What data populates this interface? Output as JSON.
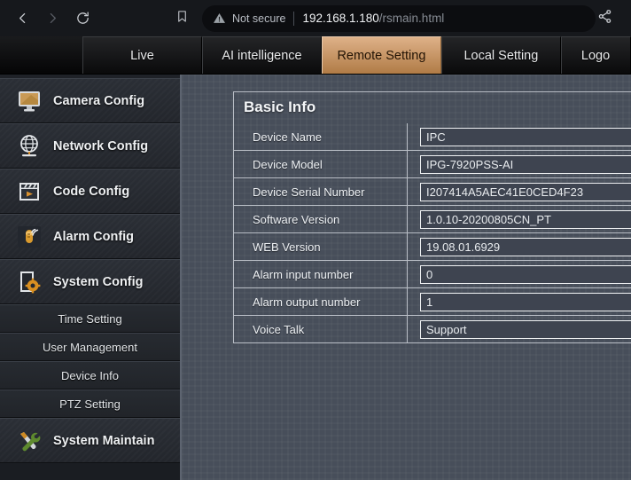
{
  "browser": {
    "back_icon": "back-arrow-icon",
    "forward_icon": "forward-arrow-icon",
    "reload_icon": "reload-icon",
    "bookmark_icon": "bookmark-icon",
    "security_icon": "warning-triangle-icon",
    "security_label": "Not secure",
    "url_host": "192.168.1.180",
    "url_path": "/rsmain.html",
    "share_icon": "share-icon"
  },
  "tabs": [
    {
      "label": "Live",
      "active": false
    },
    {
      "label": "AI intelligence",
      "active": false
    },
    {
      "label": "Remote Setting",
      "active": true
    },
    {
      "label": "Local Setting",
      "active": false
    },
    {
      "label": "Logo",
      "active": false
    }
  ],
  "sidebar": {
    "items": [
      {
        "label": "Camera Config",
        "icon": "monitor-icon"
      },
      {
        "label": "Network Config",
        "icon": "globe-icon"
      },
      {
        "label": "Code Config",
        "icon": "film-play-icon"
      },
      {
        "label": "Alarm Config",
        "icon": "alarm-bell-icon"
      },
      {
        "label": "System Config",
        "icon": "document-gear-icon"
      }
    ],
    "subitems": [
      {
        "label": "Time Setting"
      },
      {
        "label": "User Management"
      },
      {
        "label": "Device Info"
      },
      {
        "label": "PTZ Setting"
      }
    ],
    "maintain": {
      "label": "System Maintain",
      "icon": "wrench-screwdriver-icon"
    }
  },
  "main": {
    "panel_title": "Basic Info",
    "rows": [
      {
        "label": "Device Name",
        "value": "IPC"
      },
      {
        "label": "Device Model",
        "value": "IPG-7920PSS-AI"
      },
      {
        "label": "Device Serial Number",
        "value": "I207414A5AEC41E0CED4F23"
      },
      {
        "label": "Software Version",
        "value": "1.0.10-20200805CN_PT"
      },
      {
        "label": "WEB Version",
        "value": "19.08.01.6929"
      },
      {
        "label": "Alarm input number",
        "value": "0"
      },
      {
        "label": "Alarm output number",
        "value": "1"
      },
      {
        "label": "Voice Talk",
        "value": "Support"
      }
    ]
  },
  "colors": {
    "accent": "#b07b46",
    "accent_light": "#deb188",
    "content_bg": "#474e5a",
    "sidebar_bg": "#23262c",
    "chrome_bg": "#16181c"
  }
}
